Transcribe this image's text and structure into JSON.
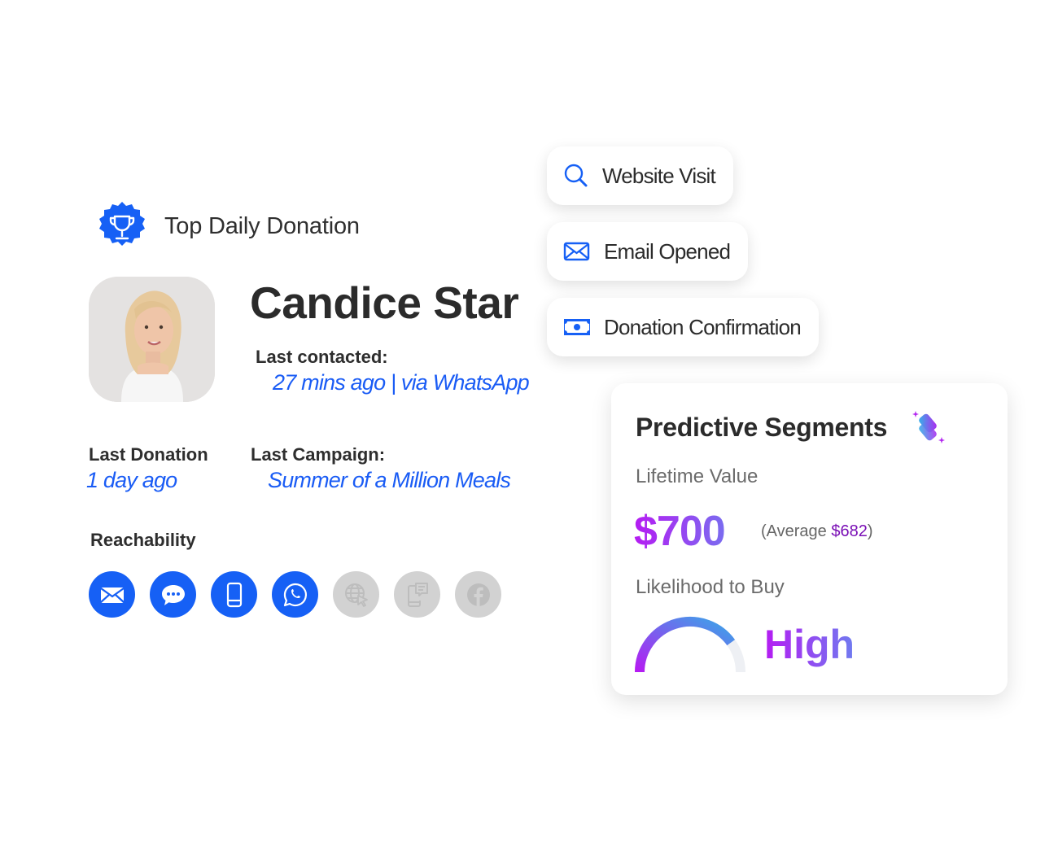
{
  "badge": {
    "title": "Top Daily Donation",
    "icon": "trophy-icon",
    "color": "#1660f5"
  },
  "profile": {
    "name": "Candice Star",
    "avatar": "avatar-photo",
    "last_contacted_label": "Last contacted:",
    "last_contacted_value": "27 mins ago | via WhatsApp",
    "last_donation_label": "Last Donation",
    "last_donation_value": "1 day ago",
    "last_campaign_label": "Last Campaign:",
    "last_campaign_value": "Summer of a Million Meals"
  },
  "reachability": {
    "label": "Reachability",
    "channels": [
      {
        "name": "email",
        "icon": "email-icon",
        "active": true
      },
      {
        "name": "sms",
        "icon": "chat-bubble-icon",
        "active": true
      },
      {
        "name": "mobile-push",
        "icon": "mobile-phone-icon",
        "active": true
      },
      {
        "name": "whatsapp",
        "icon": "whatsapp-icon",
        "active": true
      },
      {
        "name": "web",
        "icon": "globe-cursor-icon",
        "active": false
      },
      {
        "name": "in-app",
        "icon": "phone-message-icon",
        "active": false
      },
      {
        "name": "facebook",
        "icon": "facebook-icon",
        "active": false
      }
    ],
    "active_color": "#1660f5",
    "inactive_color": "#d2d2d2"
  },
  "activities": [
    {
      "label": "Website Visit",
      "icon": "search-icon"
    },
    {
      "label": "Email Opened",
      "icon": "envelope-icon"
    },
    {
      "label": "Donation Confirmation",
      "icon": "cash-icon"
    }
  ],
  "predictive": {
    "title": "Predictive Segments",
    "icon": "sparkle-segments-icon",
    "lifetime_value_label": "Lifetime Value",
    "lifetime_value": "$700",
    "average_prefix": "(Average ",
    "average_value": "$682",
    "average_suffix": ")",
    "likelihood_label": "Likelihood to Buy",
    "likelihood_value": "High",
    "likelihood_gauge_fraction": 0.8
  }
}
